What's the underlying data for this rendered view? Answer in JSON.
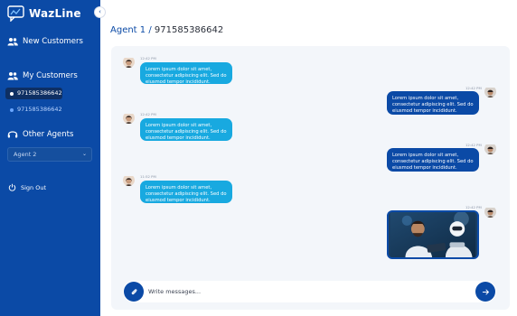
{
  "app": {
    "name": "WazLine"
  },
  "sidebar": {
    "new_customers": "New Customers",
    "my_customers": "My Customers",
    "customers": [
      {
        "label": "971585386642",
        "active": true
      },
      {
        "label": "971585386642",
        "active": false
      }
    ],
    "other_agents": "Other Agents",
    "agent_select": {
      "selected": "Agent 2"
    },
    "sign_out": "Sign Out"
  },
  "header": {
    "agent": "Agent 1",
    "separator": "/",
    "phone": "971585386642"
  },
  "messages": [
    {
      "dir": "in",
      "time": "12:42 PM",
      "text": "Lorem ipsum dolor sit amet, consectetur adipiscing elit. Sed do eiusmod tempor incididunt."
    },
    {
      "dir": "out",
      "time": "12:42 PM",
      "text": "Lorem ipsum dolor sit amet, consectetur adipiscing elit. Sed do eiusmod tempor incididunt."
    },
    {
      "dir": "in",
      "time": "12:42 PM",
      "text": "Lorem ipsum dolor sit amet, consectetur adipiscing elit. Sed do eiusmod tempor incididunt."
    },
    {
      "dir": "out",
      "time": "12:42 PM",
      "text": "Lorem ipsum dolor sit amet, consectetur adipiscing elit. Sed do eiusmod tempor incididunt."
    },
    {
      "dir": "in",
      "time": "11:52 PM",
      "text": "Lorem ipsum dolor sit amet, consectetur adipiscing elit. Sed do eiusmod tempor incididunt."
    },
    {
      "dir": "out",
      "time": "12:42 PM",
      "image": "man-with-robot-tablet-photo"
    }
  ],
  "composer": {
    "placeholder": "Write messages..."
  },
  "colors": {
    "sidebar": "#0b4aa6",
    "incoming": "#18a9e0",
    "outgoing": "#0b4aa6",
    "chat_bg": "#f3f6fa"
  },
  "icons": {
    "logo": "chat-bubble-logo-icon",
    "new_customers": "users-icon",
    "my_customers": "users-icon",
    "other_agents": "headset-icon",
    "sign_out": "power-icon",
    "attach": "paperclip-icon",
    "send": "arrow-right-icon",
    "collapse": "chevron-left-icon"
  }
}
